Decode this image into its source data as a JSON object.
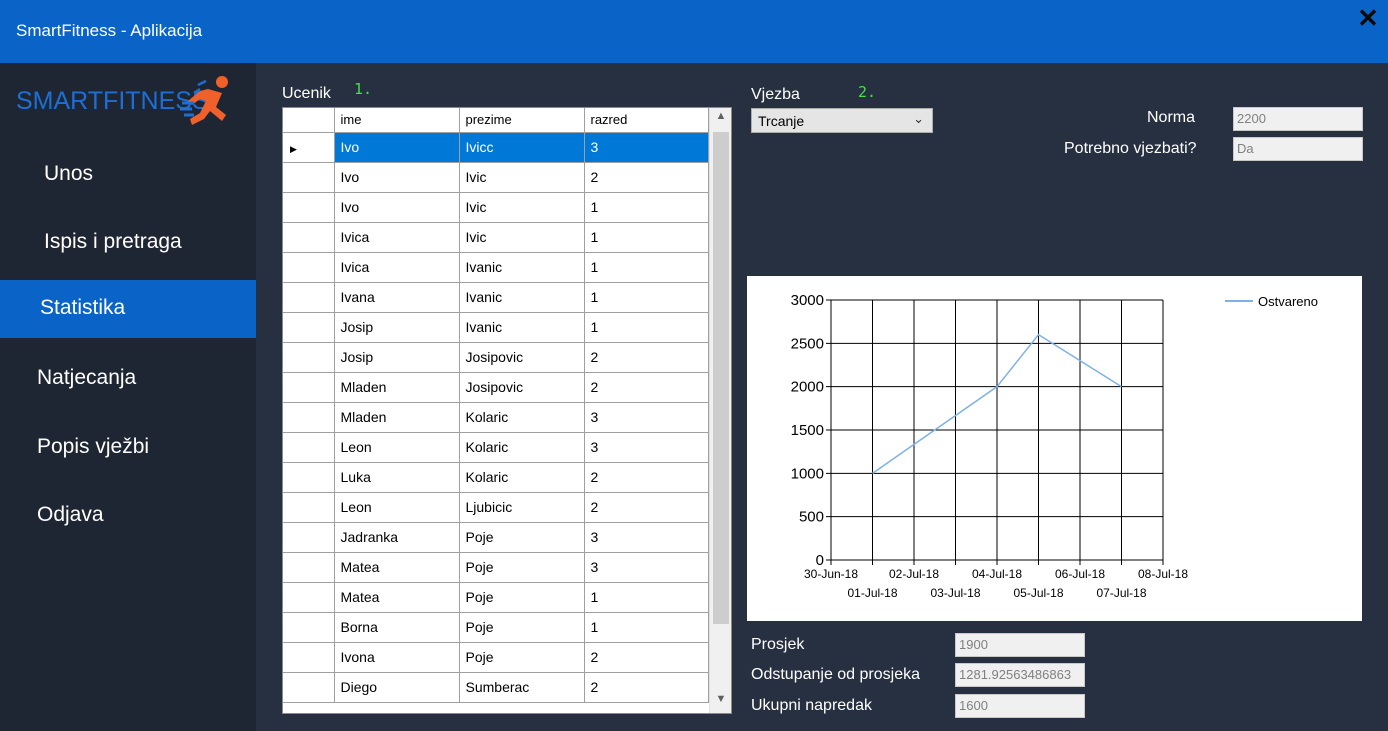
{
  "window": {
    "title": "SmartFitness - Aplikacija",
    "close_glyph": "✕"
  },
  "sidebar": {
    "logo_text": "SMARTFITNESS",
    "items": [
      {
        "label": "Unos",
        "active": false
      },
      {
        "label": "Ispis i pretraga",
        "active": false
      },
      {
        "label": "Statistika",
        "active": true
      },
      {
        "label": "Natjecanja",
        "active": false
      },
      {
        "label": "Popis vježbi",
        "active": false
      },
      {
        "label": "Odjava",
        "active": false
      }
    ]
  },
  "students": {
    "label": "Ucenik",
    "marker": "1.",
    "columns": [
      "ime",
      "prezime",
      "razred"
    ],
    "rows": [
      [
        "Ivo",
        "Ivicc",
        "3"
      ],
      [
        "Ivo",
        "Ivic",
        "2"
      ],
      [
        "Ivo",
        "Ivic",
        "1"
      ],
      [
        "Ivica",
        "Ivic",
        "1"
      ],
      [
        "Ivica",
        "Ivanic",
        "1"
      ],
      [
        "Ivana",
        "Ivanic",
        "1"
      ],
      [
        "Josip",
        "Ivanic",
        "1"
      ],
      [
        "Josip",
        "Josipovic",
        "2"
      ],
      [
        "Mladen",
        "Josipovic",
        "2"
      ],
      [
        "Mladen",
        "Kolaric",
        "3"
      ],
      [
        "Leon",
        "Kolaric",
        "3"
      ],
      [
        "Luka",
        "Kolaric",
        "2"
      ],
      [
        "Leon",
        "Ljubicic",
        "2"
      ],
      [
        "Jadranka",
        "Poje",
        "3"
      ],
      [
        "Matea",
        "Poje",
        "3"
      ],
      [
        "Matea",
        "Poje",
        "1"
      ],
      [
        "Borna",
        "Poje",
        "1"
      ],
      [
        "Ivona",
        "Poje",
        "2"
      ],
      [
        "Diego",
        "Sumberac",
        "2"
      ]
    ],
    "selected_row": 0
  },
  "exercise": {
    "label": "Vjezba",
    "marker": "2.",
    "selected": "Trcanje",
    "norma_label": "Norma",
    "norma_value": "2200",
    "potrebno_label": "Potrebno vjezbati?",
    "potrebno_value": "Da"
  },
  "stats": {
    "prosjek_label": "Prosjek",
    "prosjek_value": "1900",
    "odstupanje_label": "Odstupanje od prosjeka",
    "odstupanje_value": "1281.92563486863",
    "napredak_label": "Ukupni napredak",
    "napredak_value": "1600"
  },
  "chart_data": {
    "type": "line",
    "x": [
      "01-Jul-18",
      "04-Jul-18",
      "05-Jul-18",
      "07-Jul-18"
    ],
    "series": [
      {
        "name": "Ostvareno",
        "values": [
          1000,
          2000,
          2600,
          2000
        ],
        "color": "#7fb2e8"
      }
    ],
    "x_ticks": [
      "30-Jun-18",
      "01-Jul-18",
      "02-Jul-18",
      "03-Jul-18",
      "04-Jul-18",
      "05-Jul-18",
      "06-Jul-18",
      "07-Jul-18",
      "08-Jul-18"
    ],
    "y_ticks": [
      0,
      500,
      1000,
      1500,
      2000,
      2500,
      3000
    ],
    "ylim": [
      0,
      3000
    ],
    "grid": true,
    "legend": "top-right"
  }
}
